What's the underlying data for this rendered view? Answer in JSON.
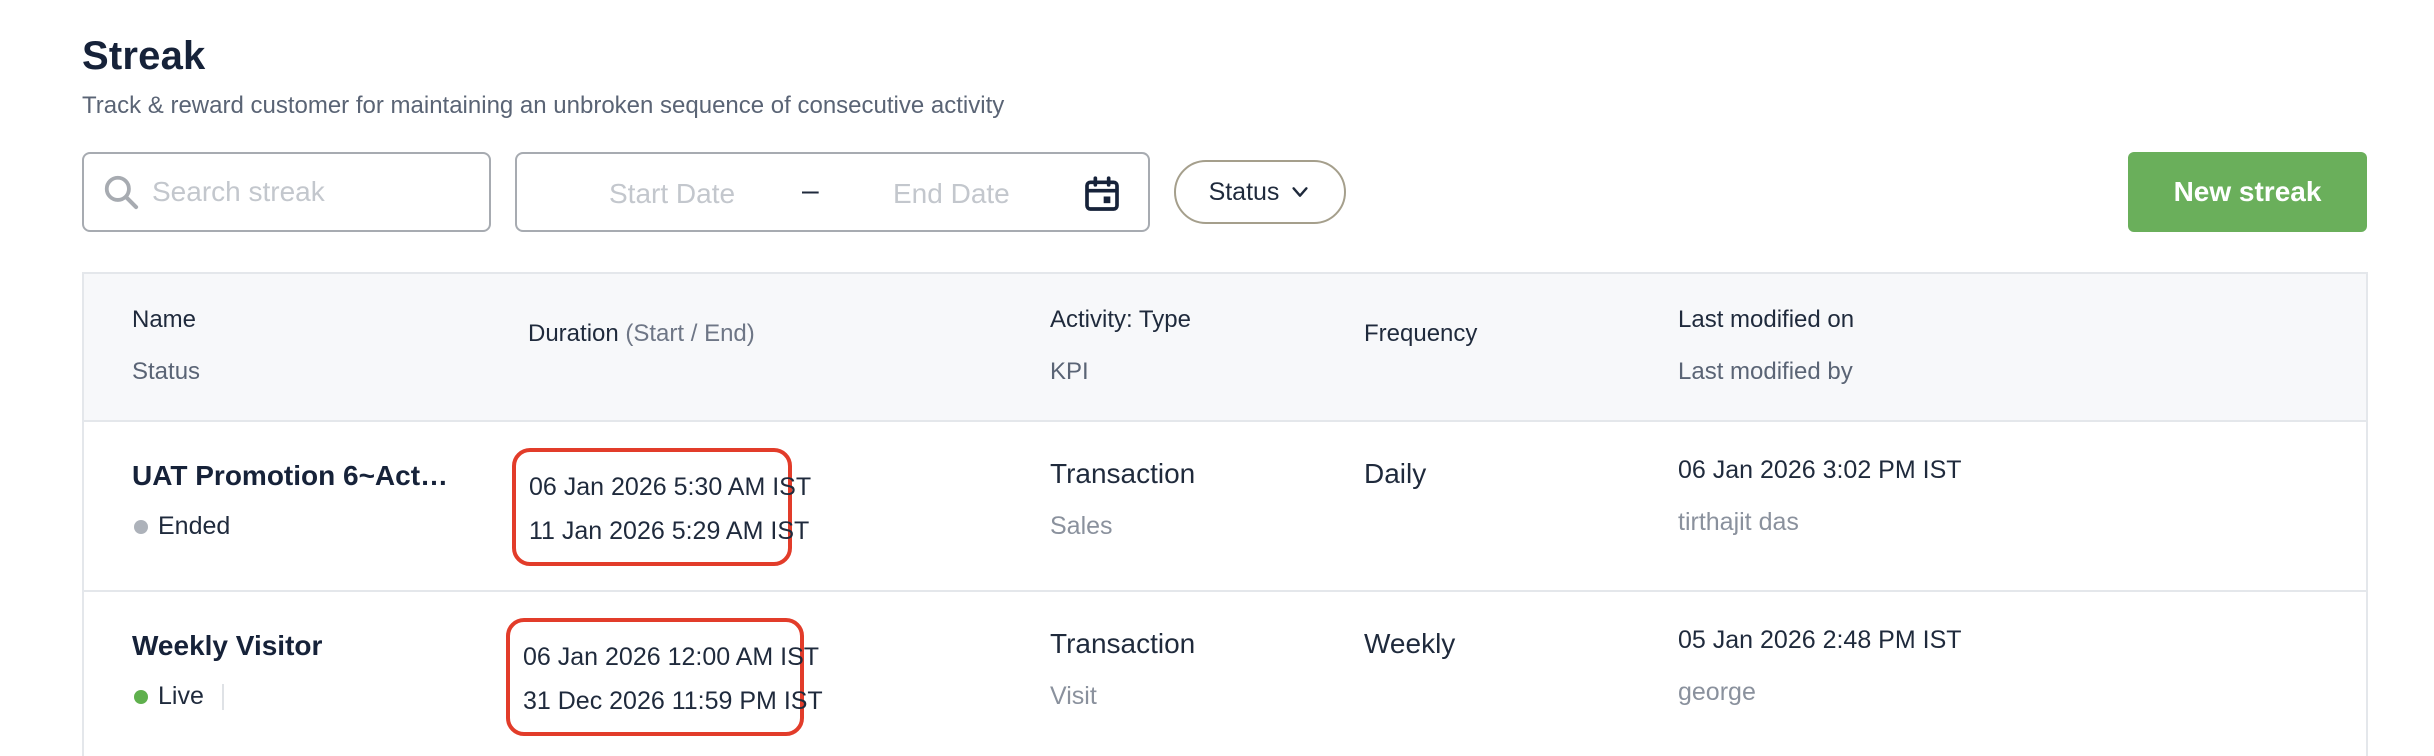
{
  "header": {
    "title": "Streak",
    "subtitle": "Track & reward customer for maintaining an unbroken sequence of consecutive activity"
  },
  "toolbar": {
    "search_placeholder": "Search streak",
    "start_date_placeholder": "Start Date",
    "date_separator": "–",
    "end_date_placeholder": "End Date",
    "status_filter_label": "Status",
    "new_button_label": "New streak",
    "icons": {
      "search": "search-icon",
      "calendar": "calendar-icon",
      "chevron": "chevron-down-icon"
    }
  },
  "table": {
    "columns": {
      "name": "Name",
      "status": "Status",
      "duration": "Duration",
      "duration_hint": "(Start / End)",
      "activity_type": "Activity: Type",
      "kpi": "KPI",
      "frequency": "Frequency",
      "last_modified_on": "Last modified on",
      "last_modified_by": "Last modified by"
    },
    "rows": [
      {
        "name": "UAT Promotion 6~Act…",
        "status": "Ended",
        "status_color": "#adb2ba",
        "start": "06 Jan 2026 5:30 AM IST",
        "end": "11 Jan 2026 5:29 AM IST",
        "activity_type": "Transaction",
        "kpi": "Sales",
        "frequency": "Daily",
        "modified_on": "06 Jan 2026 3:02 PM IST",
        "modified_by": "tirthajit das"
      },
      {
        "name": "Weekly Visitor",
        "status": "Live",
        "status_color": "#5fb04d",
        "start": "06 Jan 2026 12:00 AM IST",
        "end": "31 Dec 2026 11:59 PM IST",
        "activity_type": "Transaction",
        "kpi": "Visit",
        "frequency": "Weekly",
        "modified_on": "05 Jan 2026 2:48 PM IST",
        "modified_by": "george"
      }
    ]
  },
  "colors": {
    "primary_button": "#6aaf5b",
    "highlight_border": "#e23c2a",
    "live": "#5fb04d",
    "ended": "#adb2ba"
  }
}
